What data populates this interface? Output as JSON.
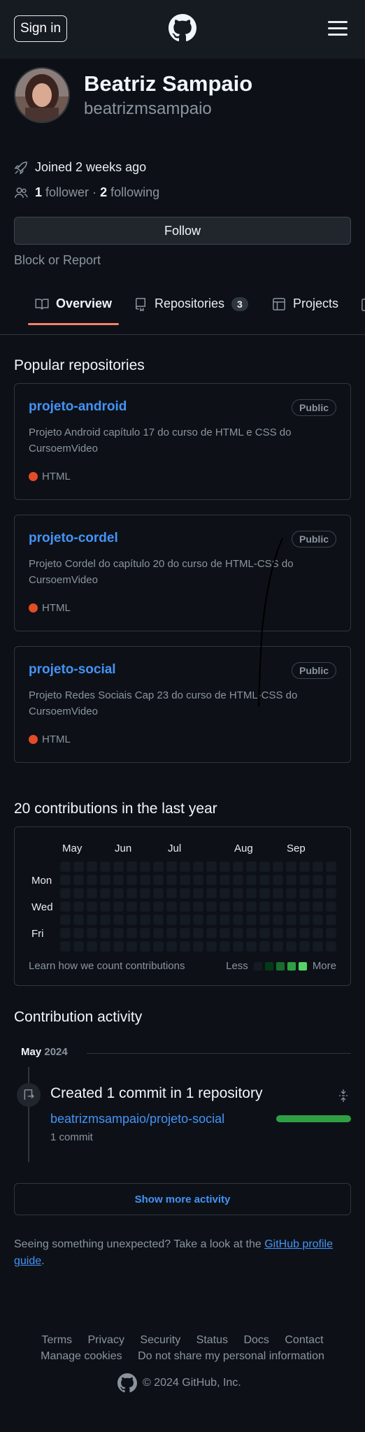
{
  "header": {
    "sign_in_label": "Sign in"
  },
  "profile": {
    "name": "Beatriz Sampaio",
    "login": "beatrizmsampaio",
    "joined": "Joined 2 weeks ago",
    "followers_count": "1",
    "followers_label": "follower",
    "separator": "·",
    "following_count": "2",
    "following_label": "following",
    "follow_label": "Follow",
    "block_label": "Block or Report"
  },
  "tabs": [
    {
      "label": "Overview"
    },
    {
      "label": "Repositories",
      "count": "3"
    },
    {
      "label": "Projects"
    }
  ],
  "popular": {
    "title": "Popular repositories",
    "repos": [
      {
        "name": "projeto-android",
        "visibility": "Public",
        "description": "Projeto Android capítulo 17 do curso de HTML e CSS do CursoemVideo",
        "language": "HTML",
        "language_color": "#e34c26"
      },
      {
        "name": "projeto-cordel",
        "visibility": "Public",
        "description": "Projeto Cordel do capítulo 20 do curso de HTML-CSS do CursoemVideo",
        "language": "HTML",
        "language_color": "#e34c26"
      },
      {
        "name": "projeto-social",
        "visibility": "Public",
        "description": "Projeto Redes Sociais Cap 23 do curso de HTML-CSS do CursoemVideo",
        "language": "HTML",
        "language_color": "#e34c26"
      }
    ]
  },
  "contributions": {
    "title": "20 contributions in the last year",
    "months": [
      "May",
      "Jun",
      "Jul",
      "Aug",
      "Sep"
    ],
    "days": [
      "Mon",
      "Wed",
      "Fri"
    ],
    "learn_label": "Learn how we count contributions",
    "less_label": "Less",
    "more_label": "More",
    "legend_colors": [
      "#151b23",
      "#033a16",
      "#196c2e",
      "#2ea043",
      "#56d364"
    ]
  },
  "activity": {
    "title": "Contribution activity",
    "month": "May",
    "year": "2024",
    "item_title": "Created 1 commit in 1 repository",
    "repo": "beatrizmsampaio/projeto-social",
    "commits": "1 commit",
    "show_more_label": "Show more activity"
  },
  "unexpected": {
    "text": "Seeing something unexpected? Take a look at the ",
    "link": "GitHub profile guide",
    "end": "."
  },
  "footer": {
    "row1": [
      "Terms",
      "Privacy",
      "Security",
      "Status",
      "Docs",
      "Contact"
    ],
    "row2": [
      "Manage cookies",
      "Do not share my personal information"
    ],
    "copyright": "© 2024 GitHub, Inc."
  }
}
